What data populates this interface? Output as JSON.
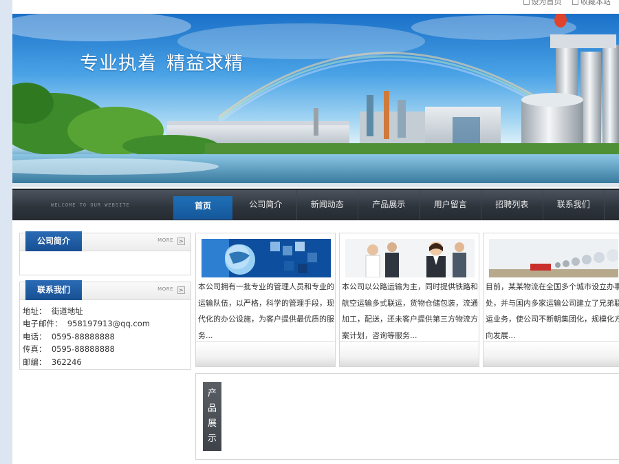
{
  "toplinks": {
    "set_home": "设为首页",
    "favorite": "收藏本站"
  },
  "banner": {
    "slogan_1": "专业执着",
    "slogan_2": "精益求精"
  },
  "nav": {
    "welcome": "WELCOME TO OUR WEBSITE",
    "items": [
      "首页",
      "公司简介",
      "新闻动态",
      "产品展示",
      "用户留言",
      "招聘列表",
      "联系我们"
    ]
  },
  "sidebar": {
    "about": {
      "title": "公司简介",
      "more": "MORE"
    },
    "contact": {
      "title": "联系我们",
      "more": "MORE",
      "lines": [
        {
          "label": "地址：",
          "value": "街道地址"
        },
        {
          "label": "电子邮件：",
          "value": "958197913@qq.com"
        },
        {
          "label": "电话：",
          "value": "0595-88888888"
        },
        {
          "label": "传真：",
          "value": "0595-88888888"
        },
        {
          "label": "邮编：",
          "value": "362246"
        }
      ]
    }
  },
  "cards": [
    {
      "text": "本公司拥有一批专业的管理人员和专业的运输队伍，以严格，科学的管理手段，现代化的办公设施，为客户提供最优质的服务..."
    },
    {
      "text": "本公司以公路运输为主，同时提供铁路和航空运输多式联运，货物仓储包装，流通加工，配送，还未客户提供第三方物流方案计划，咨询等服务..."
    },
    {
      "text": "目前，某某物流在全国多个城市设立办事处，并与国内多家运输公司建立了兄弟联运业务，使公司不断朝集团化，规模化方向发展..."
    }
  ],
  "products": {
    "title_chars": [
      "产",
      "品",
      "展",
      "示"
    ]
  },
  "colors": {
    "nav_active": "#1f6fb7",
    "tab_blue": "#2a6bb5",
    "nav_bg": "#2f353d"
  }
}
